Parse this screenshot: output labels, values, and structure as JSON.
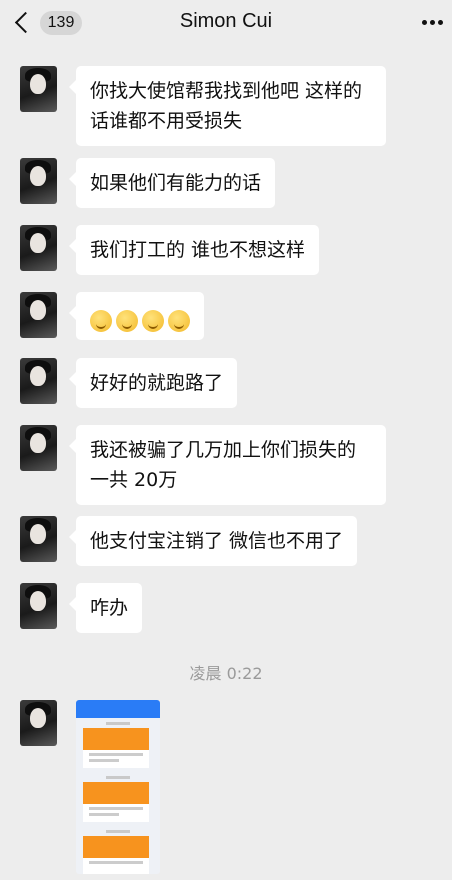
{
  "header": {
    "back_count": "139",
    "title": "Simon Cui"
  },
  "messages": [
    {
      "text": "你找大使馆帮我找到他吧 这样的\n话谁都不用受损失"
    },
    {
      "text": "如果他们有能力的话"
    },
    {
      "text": "我们打工的 谁也不想这样"
    },
    {
      "emoji": [
        "grimace-emoji",
        "grimace-emoji",
        "grimace-emoji",
        "grimace-emoji"
      ]
    },
    {
      "text": "好好的就跑路了"
    },
    {
      "text": "我还被骗了几万加上你们损失的\n一共 20万"
    },
    {
      "text": "他支付宝注销了 微信也不用了"
    },
    {
      "text": "咋办"
    }
  ],
  "timestamp": "凌晨 0:22",
  "image_message": {
    "kind": "screenshot-thumbnail"
  }
}
